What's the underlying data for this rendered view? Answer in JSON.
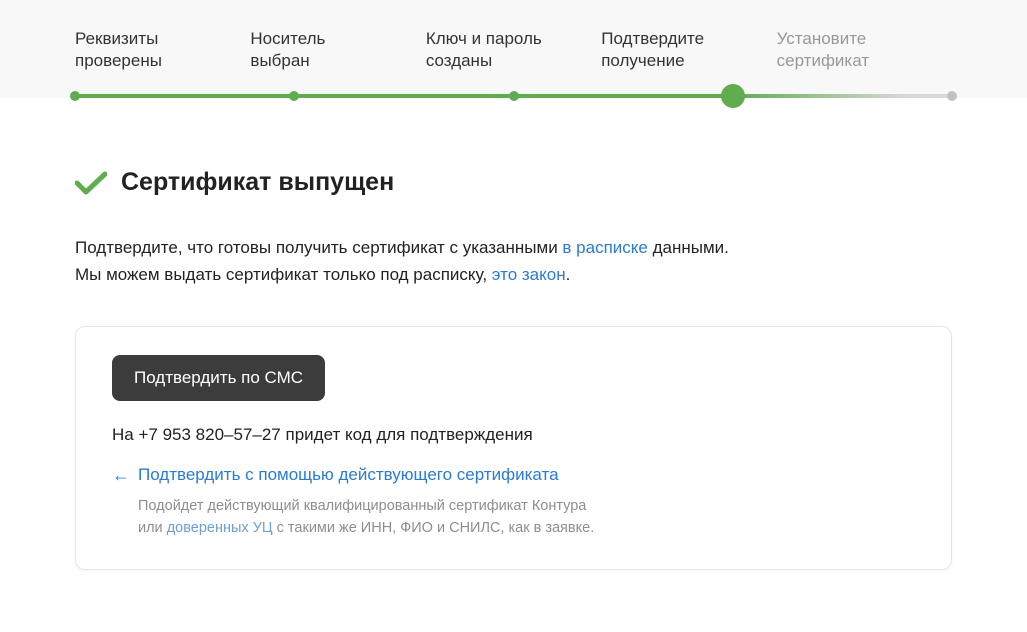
{
  "steps": [
    {
      "line1": "Реквизиты",
      "line2": "проверены"
    },
    {
      "line1": "Носитель",
      "line2": "выбран"
    },
    {
      "line1": "Ключ и пароль",
      "line2": "созданы"
    },
    {
      "line1": "Подтвердите",
      "line2": "получение"
    },
    {
      "line1": "Установите",
      "line2": "сертификат"
    }
  ],
  "title": "Сертификат выпущен",
  "intro": {
    "part1": "Подтвердите, что готовы получить сертификат с указанными ",
    "link1": "в расписке",
    "part2": " данными.",
    "part3": "Мы можем выдать сертификат только под расписку, ",
    "link2": "это закон",
    "part4": "."
  },
  "card": {
    "button": "Подтвердить по СМС",
    "sms_note_prefix": "На ",
    "phone": "+7 953 820–57–27",
    "sms_note_suffix": " придет код для подтверждения",
    "alt_link": "Подтвердить с помощью действующего сертификата",
    "alt_desc_part1": "Подойдет действующий квалифицированный сертификат Контура",
    "alt_desc_part2": "или ",
    "alt_desc_link": "доверенных УЦ",
    "alt_desc_part3": " с такими же ИНН, ФИО и СНИЛС, как в заявке."
  },
  "colors": {
    "green": "#5fad4e",
    "link": "#2a7ad8"
  }
}
